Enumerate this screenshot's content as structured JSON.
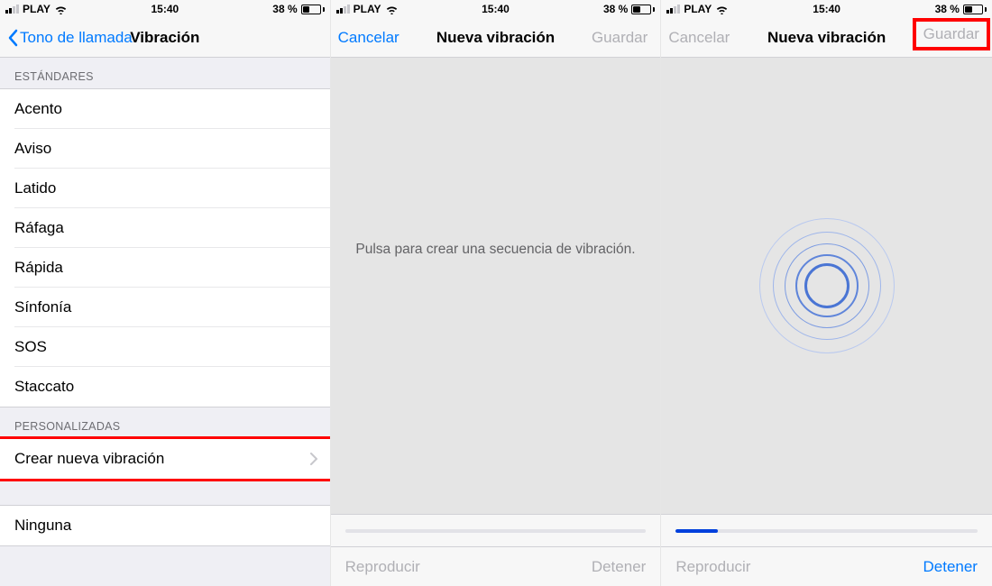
{
  "status": {
    "carrier": "PLAY",
    "time": "15:40",
    "battery_pct": "38 %",
    "battery_level": 0.38
  },
  "left": {
    "back_label": "Tono de llamada",
    "title": "Vibración",
    "section_standard": "ESTÁNDARES",
    "standard_items": [
      "Acento",
      "Aviso",
      "Latido",
      "Ráfaga",
      "Rápida",
      "Sínfonía",
      "SOS",
      "Staccato"
    ],
    "section_custom": "PERSONALIZADAS",
    "create_label": "Crear nueva vibración",
    "none_label": "Ninguna"
  },
  "middle": {
    "cancel": "Cancelar",
    "title": "Nueva vibración",
    "save": "Guardar",
    "prompt": "Pulsa para crear una secuencia de vibración.",
    "play": "Reproducir",
    "stop": "Detener",
    "progress": 0
  },
  "right": {
    "cancel": "Cancelar",
    "title": "Nueva vibración",
    "save": "Guardar",
    "play": "Reproducir",
    "stop": "Detener",
    "progress": 0.14,
    "ripple_color": "#7496e8",
    "ripple_accent": "#2f59c7"
  },
  "colors": {
    "ios_blue": "#007aff",
    "highlight_red": "#ff0000"
  }
}
